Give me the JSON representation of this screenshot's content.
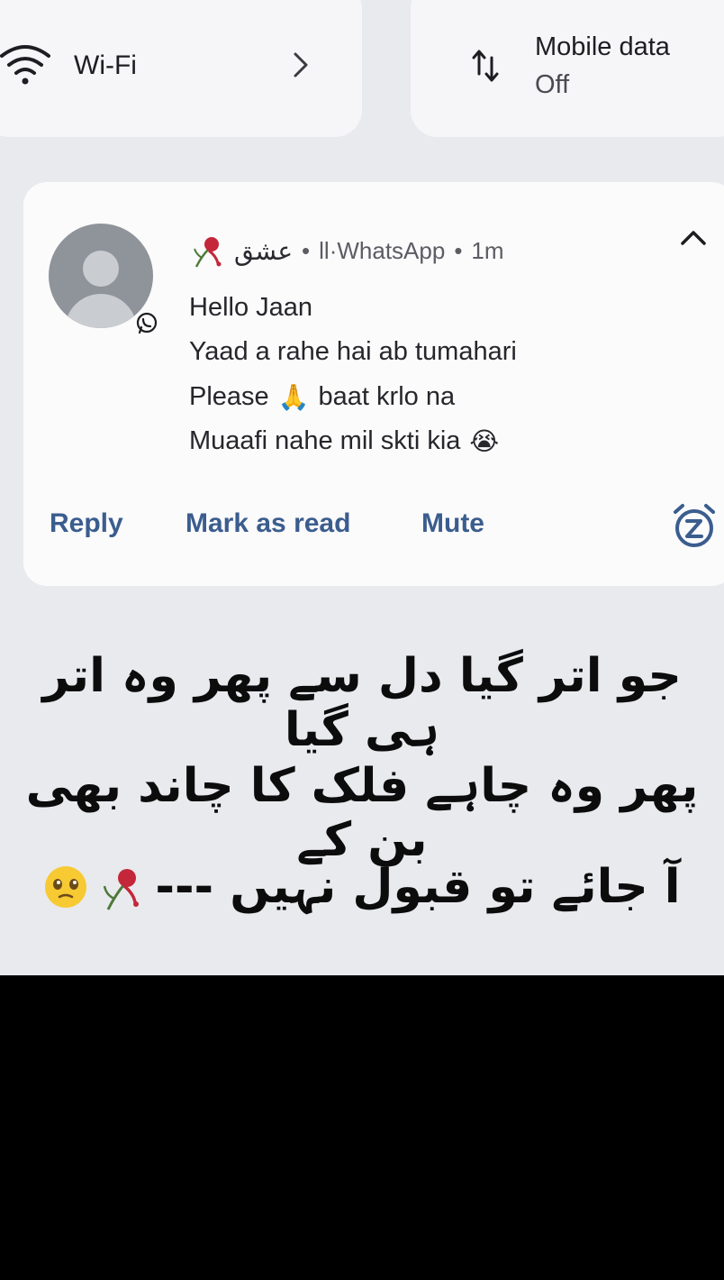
{
  "quick_settings": {
    "wifi": {
      "label": "Wi-Fi",
      "icon": "wifi-icon"
    },
    "mobile_data": {
      "label": "Mobile data",
      "status": "Off",
      "icon": "mobile-data-icon"
    }
  },
  "notification": {
    "sender": "عشق",
    "app": "ll·WhatsApp",
    "time": "1m",
    "separator": "•",
    "messages": [
      {
        "text": "Hello Jaan",
        "emoji": ""
      },
      {
        "text": "Yaad a rahe hai ab tumahari",
        "emoji": ""
      },
      {
        "text_before": "Please",
        "emoji": "🙏",
        "text_after": "baat krlo na"
      },
      {
        "text": "Muaafi nahe mil skti kia",
        "emoji": "😭"
      }
    ],
    "actions": {
      "reply": "Reply",
      "mark_read": "Mark as read",
      "mute": "Mute"
    },
    "accent_color": "#3b5d8e"
  },
  "poetry": {
    "line1": "جو اتر گیا دل سے پھر وہ اتر ہی گیا",
    "line2": "پھر وہ چاہے فلک کا چاند بھی بن کے",
    "line3": "آ جائے تو قبول نہیں ---"
  }
}
